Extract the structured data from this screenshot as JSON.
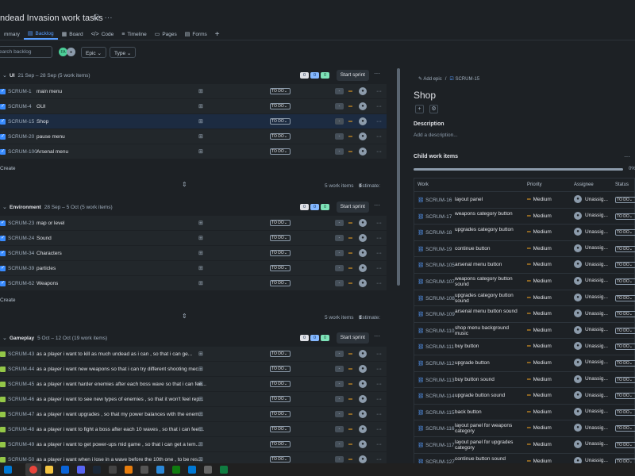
{
  "header": {
    "title": "ndead Invasion work tasks",
    "tabs": [
      {
        "label": "mmary",
        "icon": "summary-icon",
        "active": false
      },
      {
        "label": "Backlog",
        "icon": "backlog-icon",
        "active": true
      },
      {
        "label": "Board",
        "icon": "board-icon",
        "active": false
      },
      {
        "label": "Code",
        "icon": "code-icon",
        "active": false
      },
      {
        "label": "Timeline",
        "icon": "timeline-icon",
        "active": false
      },
      {
        "label": "Pages",
        "icon": "pages-icon",
        "active": false
      },
      {
        "label": "Forms",
        "icon": "forms-icon",
        "active": false
      }
    ]
  },
  "toolbar": {
    "search_placeholder": "earch backlog",
    "avatar_initials": "FA",
    "epic_label": "Epic",
    "type_label": "Type"
  },
  "sprints": [
    {
      "name": "UI",
      "dates": "21 Sep – 28 Sep (5 work items)",
      "counts": [
        "0",
        "0",
        "0"
      ],
      "start_label": "Start sprint",
      "items": [
        {
          "key": "SCRUM-1",
          "summary": "main menu",
          "status": "TO DO",
          "type": "task",
          "selected": false
        },
        {
          "key": "SCRUM-4",
          "summary": "GUI",
          "status": "TO DO",
          "type": "task",
          "selected": false
        },
        {
          "key": "SCRUM-15",
          "summary": "Shop",
          "status": "TO DO",
          "type": "task",
          "selected": true
        },
        {
          "key": "SCRUM-20",
          "summary": "pause menu",
          "status": "TO DO",
          "type": "task",
          "selected": false
        },
        {
          "key": "SCRUM-100",
          "summary": "Arsenal menu",
          "status": "TO DO",
          "type": "task",
          "selected": false
        }
      ],
      "create_label": "Create",
      "footer_items": "5 work items",
      "footer_estimate_label": "Estimate:",
      "footer_estimate": "0"
    },
    {
      "name": "Environment",
      "dates": "28 Sep – 5 Oct (5 work items)",
      "counts": [
        "0",
        "0",
        "0"
      ],
      "start_label": "Start sprint",
      "items": [
        {
          "key": "SCRUM-23",
          "summary": "map or level",
          "status": "TO DO",
          "type": "task",
          "selected": false
        },
        {
          "key": "SCRUM-24",
          "summary": "Sound",
          "status": "TO DO",
          "type": "task",
          "selected": false
        },
        {
          "key": "SCRUM-34",
          "summary": "Characters",
          "status": "TO DO",
          "type": "task",
          "selected": false
        },
        {
          "key": "SCRUM-39",
          "summary": "particles",
          "status": "TO DO",
          "type": "task",
          "selected": false
        },
        {
          "key": "SCRUM-62",
          "summary": "Weapons",
          "status": "TO DO",
          "type": "task",
          "selected": false
        }
      ],
      "create_label": "Create",
      "footer_items": "5 work items",
      "footer_estimate_label": "Estimate:",
      "footer_estimate": "0"
    },
    {
      "name": "Gameplay",
      "dates": "5 Oct – 12 Oct (19 work items)",
      "counts": [
        "0",
        "0",
        "0"
      ],
      "start_label": "Start sprint",
      "items": [
        {
          "key": "SCRUM-43",
          "summary": "as a player i want to kill as much undead as i can , so that i can ge...",
          "status": "TO DO",
          "type": "story",
          "selected": false
        },
        {
          "key": "SCRUM-44",
          "summary": "as a player i want new weapons so that i can try different shooting mec...",
          "status": "TO DO",
          "type": "story",
          "selected": false
        },
        {
          "key": "SCRUM-45",
          "summary": "as a player i want harder enemies after each boss wave so that i can fee...",
          "status": "TO DO",
          "type": "story",
          "selected": false
        },
        {
          "key": "SCRUM-46",
          "summary": "as a player i want to see new types of enemies , so that it won't feel rep...",
          "status": "TO DO",
          "type": "story",
          "selected": false
        },
        {
          "key": "SCRUM-47",
          "summary": "as a player i want upgrades , so that my power balances with the enem...",
          "status": "TO DO",
          "type": "story",
          "selected": false
        },
        {
          "key": "SCRUM-48",
          "summary": "as a player i want to fight a boss after each 10 waves , so that i can feel...",
          "status": "TO DO",
          "type": "story",
          "selected": false
        },
        {
          "key": "SCRUM-49",
          "summary": "as a player i want to get power-ups mid game , so that i can get a tem...",
          "status": "TO DO",
          "type": "story",
          "selected": false
        },
        {
          "key": "SCRUM-50",
          "summary": "as a player i want when i lose in a wave before the 10th one , to be res...",
          "status": "TO DO",
          "type": "story",
          "selected": false
        }
      ]
    }
  ],
  "detail": {
    "add_epic_label": "Add epic",
    "breadcrumb_key": "SCRUM-15",
    "title": "Shop",
    "description_heading": "Description",
    "description_placeholder": "Add a description...",
    "child_heading": "Child work items",
    "progress_pct": "0%",
    "progress_value": 0,
    "columns": {
      "work": "Work",
      "priority": "Priority",
      "assignee": "Assignee",
      "status": "Status"
    },
    "children": [
      {
        "key": "SCRUM-16",
        "summary": "layout panel",
        "priority": "Medium",
        "assignee": "Unassig...",
        "status": "TO DO"
      },
      {
        "key": "SCRUM-17",
        "summary": "weapons category button",
        "priority": "Medium",
        "assignee": "Unassig...",
        "status": "TO DO"
      },
      {
        "key": "SCRUM-18",
        "summary": "upgrades category button",
        "priority": "Medium",
        "assignee": "Unassig...",
        "status": "TO DO"
      },
      {
        "key": "SCRUM-19",
        "summary": "continue button",
        "priority": "Medium",
        "assignee": "Unassig...",
        "status": "TO DO"
      },
      {
        "key": "SCRUM-105",
        "summary": "arsenal menu button",
        "priority": "Medium",
        "assignee": "Unassig...",
        "status": "TO DO"
      },
      {
        "key": "SCRUM-107",
        "summary": "weapons category button sound",
        "priority": "Medium",
        "assignee": "Unassig...",
        "status": "TO DO"
      },
      {
        "key": "SCRUM-108",
        "summary": "upgrades category button sound",
        "priority": "Medium",
        "assignee": "Unassig...",
        "status": "TO DO"
      },
      {
        "key": "SCRUM-109",
        "summary": "arsenal menu button sound",
        "priority": "Medium",
        "assignee": "Unassig...",
        "status": "TO DO"
      },
      {
        "key": "SCRUM-110",
        "summary": "shop menu background music",
        "priority": "Medium",
        "assignee": "Unassig...",
        "status": "TO DO"
      },
      {
        "key": "SCRUM-111",
        "summary": "buy button",
        "priority": "Medium",
        "assignee": "Unassig...",
        "status": "TO DO"
      },
      {
        "key": "SCRUM-112",
        "summary": "upgrade button",
        "priority": "Medium",
        "assignee": "Unassig...",
        "status": "TO DO"
      },
      {
        "key": "SCRUM-113",
        "summary": "buy button sound",
        "priority": "Medium",
        "assignee": "Unassig...",
        "status": "TO DO"
      },
      {
        "key": "SCRUM-114",
        "summary": "upgrade button sound",
        "priority": "Medium",
        "assignee": "Unassig...",
        "status": "TO DO"
      },
      {
        "key": "SCRUM-115",
        "summary": "back button",
        "priority": "Medium",
        "assignee": "Unassig...",
        "status": "TO DO"
      },
      {
        "key": "SCRUM-116",
        "summary": "layout panel for weapons category",
        "priority": "Medium",
        "assignee": "Unassig...",
        "status": "TO DO"
      },
      {
        "key": "SCRUM-117",
        "summary": "layout panel for upgrades category",
        "priority": "Medium",
        "assignee": "Unassig...",
        "status": "TO DO"
      },
      {
        "key": "SCRUM-127",
        "summary": "continue button sound",
        "priority": "Medium",
        "assignee": "Unassig...",
        "status": "TO DO"
      }
    ]
  },
  "taskbar": {
    "apps": [
      "windows-logo",
      "chrome-icon",
      "file-explorer-icon",
      "outlook-icon",
      "discord-icon",
      "steam-icon",
      "unity-icon",
      "blender-icon",
      "github-icon",
      "calendar-icon",
      "xbox-icon",
      "vscode-icon",
      "unity-hub-icon",
      "excel-icon"
    ]
  }
}
